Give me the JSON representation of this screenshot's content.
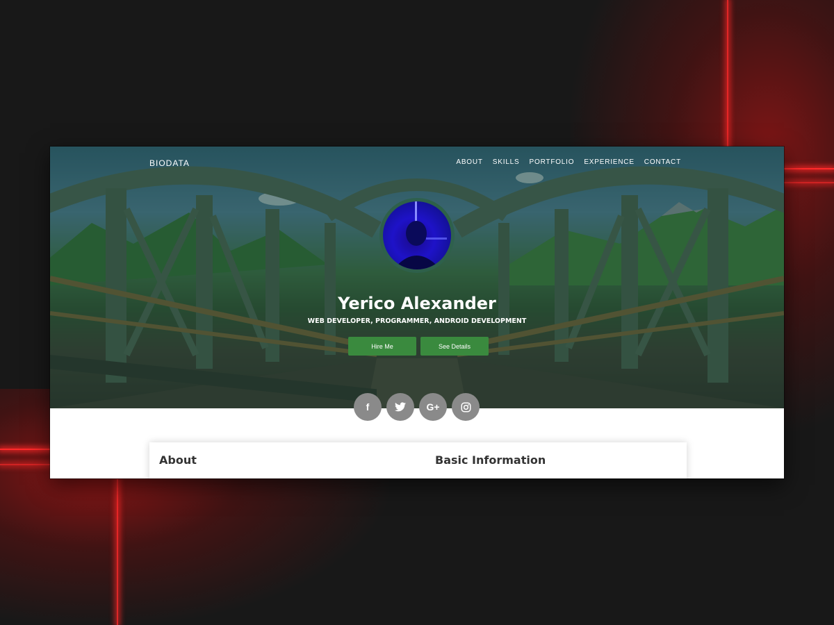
{
  "site": {
    "brand": "BIODATA",
    "nav": [
      "ABOUT",
      "SKILLS",
      "PORTFOLIO",
      "EXPERIENCE",
      "CONTACT"
    ]
  },
  "hero": {
    "name": "Yerico Alexander",
    "tagline": "WEB DEVELOPER, PROGRAMMER, ANDROID DEVELOPMENT",
    "buttons": {
      "hire": "Hire Me",
      "details": "See Details"
    }
  },
  "socials": [
    {
      "icon": "facebook-icon",
      "glyph": "f"
    },
    {
      "icon": "twitter-icon",
      "glyph": ""
    },
    {
      "icon": "google-plus-icon",
      "glyph": "G+"
    },
    {
      "icon": "instagram-icon",
      "glyph": ""
    }
  ],
  "sections": {
    "about_title": "About",
    "basic_title": "Basic Information"
  },
  "colors": {
    "accent": "#3a8a3e",
    "social_bg": "#8a8a8a",
    "backdrop_glow": "#e01818"
  }
}
